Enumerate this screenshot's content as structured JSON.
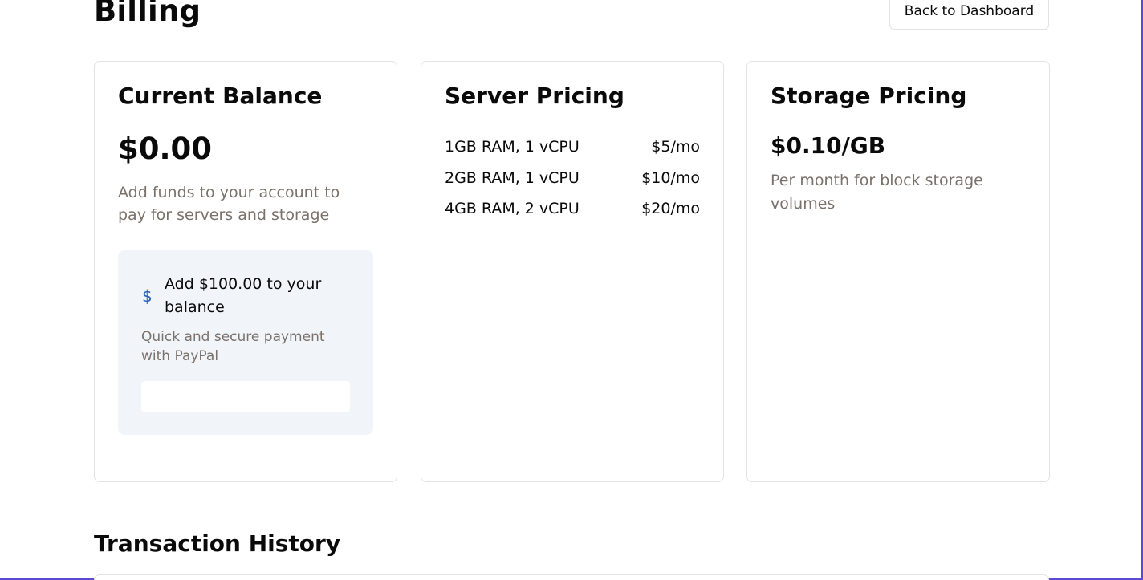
{
  "header": {
    "title": "Billing",
    "back_label": "Back to Dashboard"
  },
  "balance_card": {
    "title": "Current Balance",
    "amount": "$0.00",
    "description": "Add funds to your account to pay for servers and storage",
    "paypal": {
      "icon": "dollar-icon",
      "icon_glyph": "$",
      "icon_color": "#2563b8",
      "title": "Add $100.00 to your balance",
      "subtitle": "Quick and secure payment with PayPal"
    }
  },
  "server_card": {
    "title": "Server Pricing",
    "plans": [
      {
        "spec": "1GB RAM, 1 vCPU",
        "price": "$5/mo"
      },
      {
        "spec": "2GB RAM, 1 vCPU",
        "price": "$10/mo"
      },
      {
        "spec": "4GB RAM, 2 vCPU",
        "price": "$20/mo"
      }
    ]
  },
  "storage_card": {
    "title": "Storage Pricing",
    "price": "$0.10/GB",
    "description": "Per month for block storage volumes"
  },
  "history": {
    "title": "Transaction History"
  },
  "colors": {
    "muted_text": "#7a716b",
    "accent": "#2563b8",
    "panel_bg": "#f1f5fa",
    "border": "#e3e3e3"
  }
}
